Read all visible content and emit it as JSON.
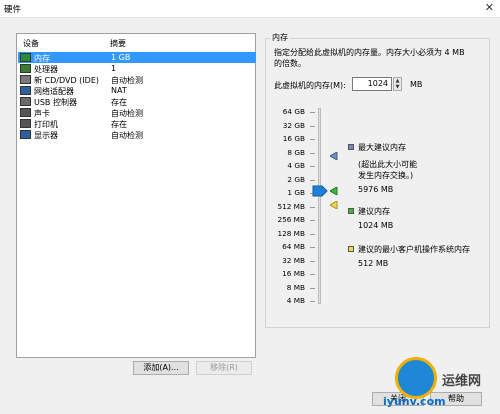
{
  "window": {
    "title": "硬件",
    "close_glyph": "✕"
  },
  "device_list": {
    "column_device": "设备",
    "column_summary": "摘要",
    "selected_index": 0,
    "rows": [
      {
        "name": "内存",
        "summary": "1 GB",
        "icon": "memory-icon",
        "color": "#2e8b3a"
      },
      {
        "name": "处理器",
        "summary": "1",
        "icon": "processor-icon",
        "color": "#3a7d2e"
      },
      {
        "name": "新 CD/DVD (IDE)",
        "summary": "自动检测",
        "icon": "cd-dvd-icon",
        "color": "#7a7a7a"
      },
      {
        "name": "网络适配器",
        "summary": "NAT",
        "icon": "network-adapter-icon",
        "color": "#2f5f9e"
      },
      {
        "name": "USB 控制器",
        "summary": "存在",
        "icon": "usb-icon",
        "color": "#6b6b6b"
      },
      {
        "name": "声卡",
        "summary": "自动检测",
        "icon": "sound-card-icon",
        "color": "#555555"
      },
      {
        "name": "打印机",
        "summary": "存在",
        "icon": "printer-icon",
        "color": "#555555"
      },
      {
        "name": "显示器",
        "summary": "自动检测",
        "icon": "display-icon",
        "color": "#2f5f9e"
      }
    ]
  },
  "buttons": {
    "add": "添加(A)...",
    "remove": "移除(R)",
    "ok": "关闭",
    "help": "帮助"
  },
  "memory": {
    "group_title": "内存",
    "description_line1": "指定分配给此虚拟机的内存量。内存大小必须为 4 MB",
    "description_line2": "的倍数。",
    "label": "此虚拟机的内存(M):",
    "value": "1024",
    "unit": "MB",
    "ticks": [
      "64 GB",
      "32 GB",
      "16 GB",
      "8 GB",
      "4 GB",
      "2 GB",
      "1 GB",
      "512 MB",
      "256 MB",
      "128 MB",
      "64 MB",
      "32 MB",
      "16 MB",
      "8 MB",
      "4 MB"
    ],
    "selected_tick": "1 GB",
    "legend": {
      "max": {
        "title": "最大建议内存",
        "note1": "(超出此大小可能",
        "note2": "发生内存交换。)",
        "value": "5976 MB",
        "color": "#6b8fb8"
      },
      "recommended": {
        "title": "建议内存",
        "value": "1024 MB",
        "color": "#3bb83b"
      },
      "min": {
        "title": "建议的最小客户机操作系统内存",
        "value": "512 MB",
        "color": "#f2d84a"
      }
    }
  },
  "watermark": {
    "text": "运维网",
    "url": "iyunv.com"
  }
}
